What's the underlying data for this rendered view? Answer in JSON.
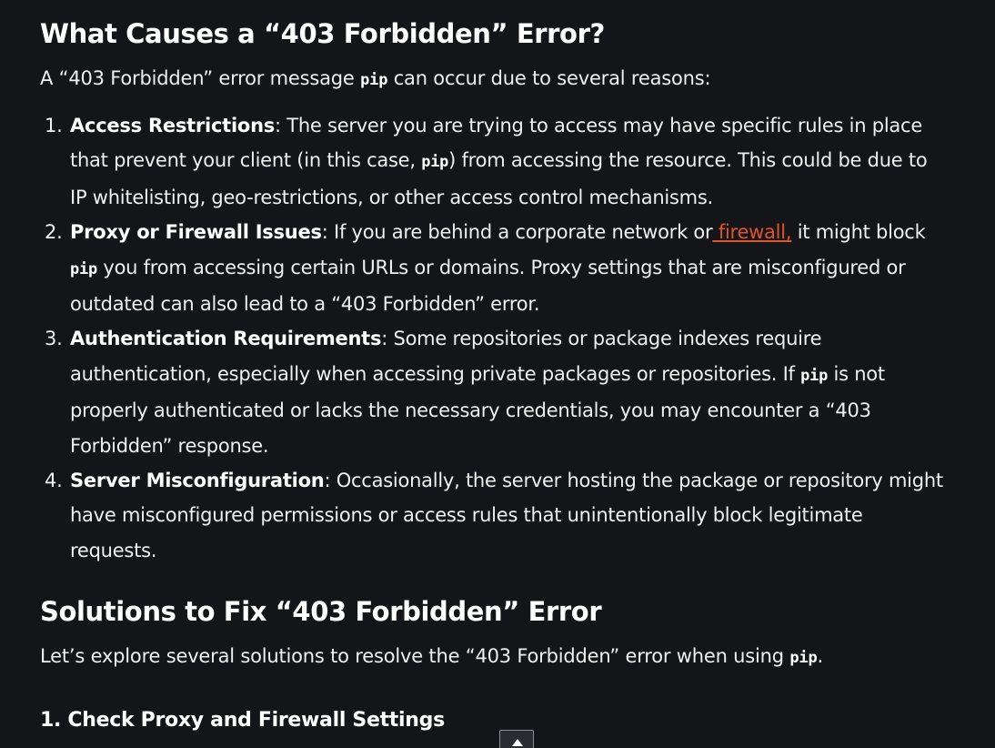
{
  "section1": {
    "heading": "What Causes a “403 Forbidden” Error?",
    "intro_before": "A “403 Forbidden” error message ",
    "intro_code": "pip",
    "intro_after": " can occur due to several reasons:"
  },
  "reasons": [
    {
      "number": "1.",
      "title": "Access Restrictions",
      "l1": ": The server you are trying to access may have specific rules in place",
      "l2_before": "that prevent your client (in this case, ",
      "l2_code": "pip",
      "l2_after": ") from accessing the resource. This could be due to",
      "l3": "IP whitelisting, geo-restrictions, or other access control mechanisms."
    },
    {
      "number": "2.",
      "title": "Proxy or Firewall Issues",
      "l1_before": ": If you are behind a corporate network or",
      "link": " firewall,",
      "l1_after": " it might block",
      "l2_code": "pip",
      "l2_after": " you from accessing certain URLs or domains. Proxy settings that are misconfigured or",
      "l3": "outdated can also lead to a “403 Forbidden” error."
    },
    {
      "number": "3.",
      "title": "Authentication Requirements",
      "l1": ": Some repositories or package indexes require",
      "l2_before": "authentication, especially when accessing private packages or repositories. If ",
      "l2_code": "pip",
      "l2_after": " is not",
      "l3": "properly authenticated or lacks the necessary credentials, you may encounter a “403",
      "l4": "Forbidden” response."
    },
    {
      "number": "4.",
      "title": "Server Misconfiguration",
      "l1": ": Occasionally, the server hosting the package or repository might",
      "l2": "have misconfigured permissions or access rules that unintentionally block legitimate",
      "l3": "requests."
    }
  ],
  "section2": {
    "heading": "Solutions to Fix “403 Forbidden” Error",
    "intro_before": "Let’s explore several solutions to resolve the “403 Forbidden” error when using ",
    "intro_code": "pip",
    "intro_after": "."
  },
  "step1": {
    "heading": "1. Check Proxy and Firewall Settings"
  },
  "colors": {
    "background": "#141519",
    "text": "#f0f0f0",
    "link": "#e0542a"
  },
  "icons": {
    "scroll_top": "chevron-up-icon"
  }
}
